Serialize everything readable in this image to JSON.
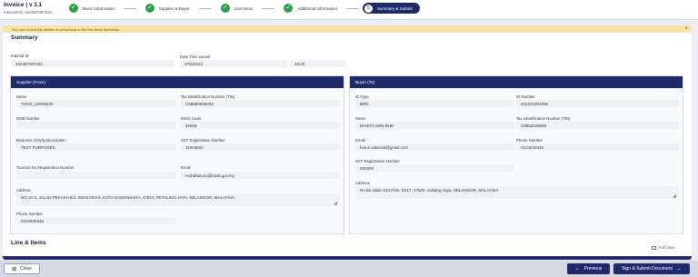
{
  "app": {
    "title": "Invoice | v 1.1",
    "internal_id_line": "Internal ID: 344487007441"
  },
  "steps": [
    {
      "label": "Basic Information",
      "state": "done"
    },
    {
      "label": "Supplier & Buyer",
      "state": "done"
    },
    {
      "label": "Line Items",
      "state": "done"
    },
    {
      "label": "Additional Information",
      "state": "done"
    },
    {
      "label": "Summary & Submit",
      "state": "active",
      "number": "5"
    }
  ],
  "notice": {
    "text": "You can review the details of conversion in the line items list below.",
    "close": "×"
  },
  "summary": {
    "title": "Summary",
    "internal_id_label": "Internal ID",
    "internal_id_value": "344487007441",
    "datetime_label": "Date Time Issued",
    "date_value": "27/6/2024",
    "time_value": "19:20"
  },
  "supplier": {
    "title": "Supplier (From)",
    "name_label": "Name",
    "name_value": "TOOS_100OKHD",
    "tin_label": "Tax Identification Number (TIN)",
    "tin_value": "C58680956033",
    "rob_label": "ROB Number",
    "rob_value": "",
    "msic_label": "MSIC Code",
    "msic_value": "42909",
    "business_label": "Business Activity Description",
    "business_value": "TEST PURPOSES",
    "sst_label": "SST Registration Number",
    "sst_value": "11003500",
    "tourism_label": "Tourism Tax Registration Number",
    "tourism_value": "",
    "email_label": "Email",
    "email_value": "mohdfairuzx@hasil.gov.my",
    "address_label": "Address",
    "address_value": "NO 10-3, JALAN PEKAKA 8/4, SEKSYEN 8, KOTA DAMANSARA, 47810, PETALING JAYA, SELANGOR, MALAYSIA",
    "phone_label": "Phone Number",
    "phone_value": "0104540346"
  },
  "buyer": {
    "title": "Buyer (To)",
    "idtype_label": "ID Type",
    "idtype_value": "BRN",
    "idnum_label": "ID Number",
    "idnum_value": "202201001096",
    "name_label": "Name",
    "name_value": "DIVETA SDN BHD",
    "tin_label": "Tax Identification Number (TIN)",
    "tin_value": "C9852228090",
    "email_label": "Email",
    "email_value": "fairuz.salamat@gmail.com",
    "phone_label": "Phone Number",
    "phone_value": "0123440346",
    "sst_label": "SST Registration Number",
    "sst_value": "000000",
    "address_label": "Address",
    "address_value": "No 56 Jalan SS17/1B, SS17, 47500, Subang Jaya, SELANGOR, MALAYSIA"
  },
  "line_items": {
    "title": "Line & Items",
    "full_view": "Full View"
  },
  "footer": {
    "close": "Close",
    "previous": "Previous",
    "sign_submit": "Sign & Submit Document"
  },
  "colors": {
    "brand": "#1f2a6b",
    "success": "#2e9e4a",
    "notice_bg": "#f7e3a5"
  }
}
